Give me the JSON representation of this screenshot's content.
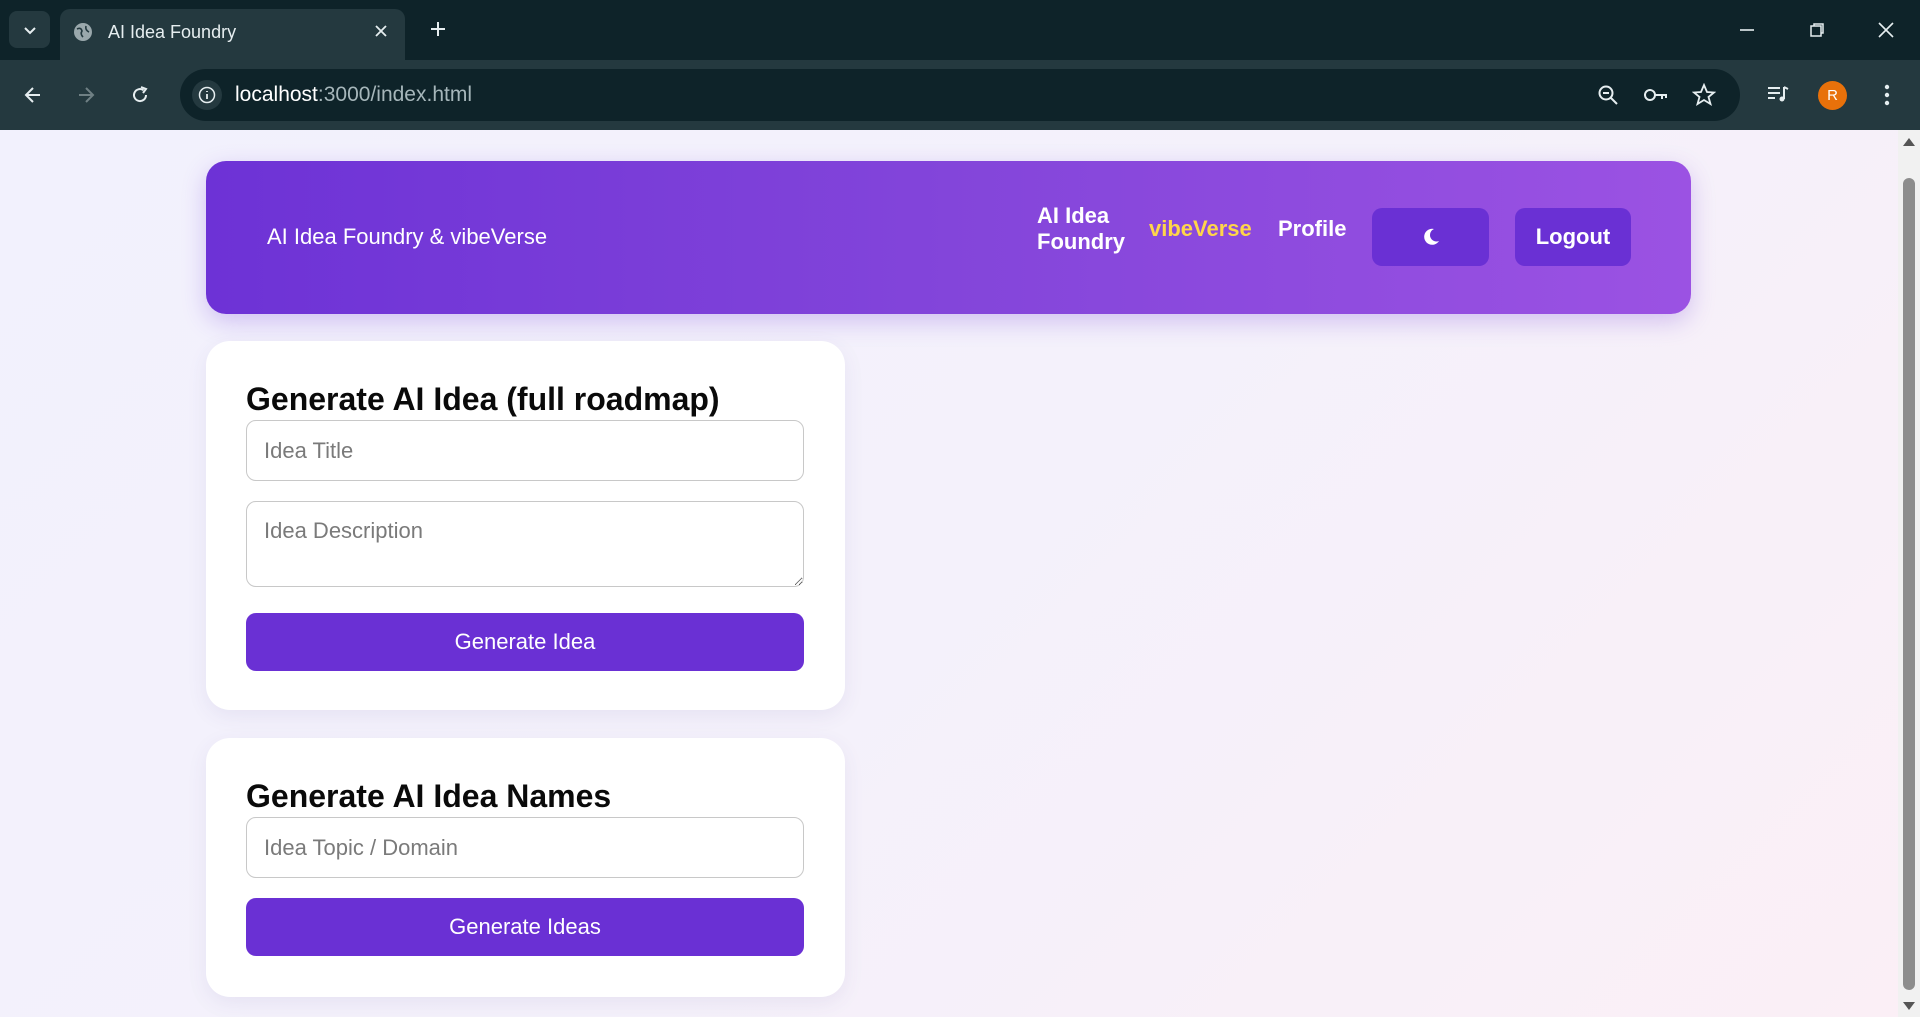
{
  "browser": {
    "tab_title": "AI Idea Foundry",
    "url_host": "localhost",
    "url_rest": ":3000/index.html",
    "profile_initial": "R",
    "icons": [
      "tab-search-icon",
      "globe-icon",
      "close-icon",
      "plus-icon",
      "minimize-icon",
      "restore-icon",
      "back-icon",
      "forward-icon",
      "reload-icon",
      "info-icon",
      "zoom-icon",
      "key-icon",
      "star-icon",
      "media-icon",
      "menu-icon"
    ]
  },
  "header": {
    "brand": "AI Idea Foundry & vibeVerse",
    "nav": {
      "foundry": "AI Idea Foundry",
      "vibeverse": "vibeVerse",
      "profile": "Profile"
    },
    "theme_icon": "moon-icon",
    "logout": "Logout"
  },
  "idea_card": {
    "title": "Generate AI Idea (full roadmap)",
    "title_placeholder": "Idea Title",
    "description_placeholder": "Idea Description",
    "button": "Generate Idea"
  },
  "names_card": {
    "title": "Generate AI Idea Names",
    "topic_placeholder": "Idea Topic / Domain",
    "button": "Generate Ideas"
  },
  "colors": {
    "accent": "#6a30d4",
    "active_nav": "#ffd54a",
    "chrome_dark": "#0e2329",
    "chrome_light": "#24393f"
  }
}
